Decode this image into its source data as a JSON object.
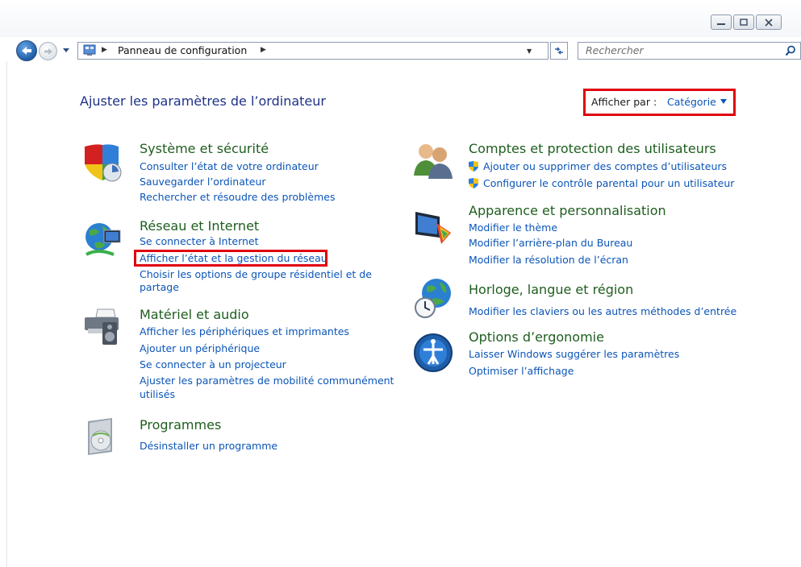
{
  "address_bar": {
    "breadcrumb": "Panneau de configuration",
    "search_placeholder": "Rechercher"
  },
  "header": {
    "title": "Ajuster les paramètres de l’ordinateur",
    "view_by_label": "Afficher par :",
    "view_by_value": "Catégorie"
  },
  "categories": {
    "system": {
      "title": "Système et sécurité",
      "links": [
        "Consulter l’état de votre ordinateur",
        "Sauvegarder l’ordinateur",
        "Rechercher et résoudre des problèmes"
      ]
    },
    "network": {
      "title": "Réseau et Internet",
      "links": [
        "Se connecter à Internet",
        "Afficher l’état et la gestion du réseau",
        "Choisir les options de groupe résidentiel et de",
        "partage"
      ]
    },
    "hardware": {
      "title": "Matériel et audio",
      "links": [
        "Afficher les périphériques et imprimantes",
        "Ajouter un périphérique",
        "Se connecter à un projecteur",
        "Ajuster les paramètres de mobilité communément",
        "utilisés"
      ]
    },
    "programs": {
      "title": "Programmes",
      "links": [
        "Désinstaller un programme"
      ]
    },
    "accounts": {
      "title": "Comptes et protection des utilisateurs",
      "links": [
        "Ajouter ou supprimer des comptes d’utilisateurs",
        "Configurer le contrôle parental pour un utilisateur"
      ]
    },
    "appearance": {
      "title": "Apparence et personnalisation",
      "links": [
        "Modifier le thème",
        "Modifier l’arrière-plan du Bureau",
        "Modifier la résolution de l’écran"
      ]
    },
    "clock": {
      "title": "Horloge, langue et région",
      "links": [
        "Modifier les claviers ou les autres méthodes d’entrée"
      ]
    },
    "ease": {
      "title": "Options d’ergonomie",
      "links": [
        "Laisser Windows suggérer les paramètres",
        "Optimiser l’affichage"
      ]
    }
  },
  "colors": {
    "link": "#0b55b8",
    "category_title": "#1e5e1e",
    "highlight": "#e0000e"
  }
}
